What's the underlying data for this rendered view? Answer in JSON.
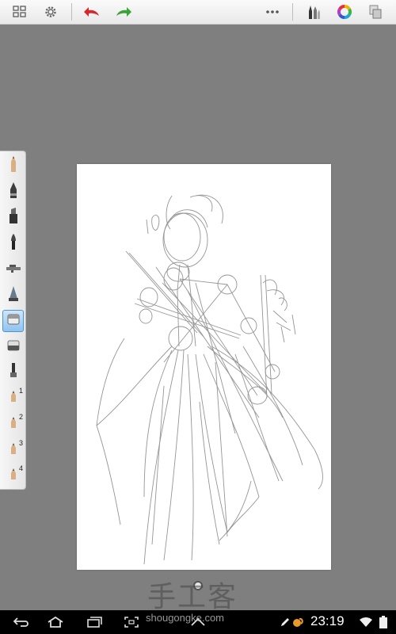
{
  "toolbar": {
    "icons": [
      "grid-icon",
      "gear-icon",
      "undo-icon",
      "redo-icon",
      "more-icon",
      "brush-library-icon",
      "color-wheel-icon",
      "layers-icon"
    ],
    "colors": {
      "undo": "#d9262c",
      "redo": "#3aa33a"
    }
  },
  "palette": {
    "tools": [
      {
        "icon": "pencil-icon"
      },
      {
        "icon": "ballpoint-pen-icon"
      },
      {
        "icon": "marker-icon"
      },
      {
        "icon": "paintbrush-icon"
      },
      {
        "icon": "airbrush-icon"
      },
      {
        "icon": "smudge-icon"
      },
      {
        "icon": "eraser-icon",
        "active": true
      },
      {
        "icon": "soft-eraser-icon"
      },
      {
        "icon": "flat-brush-icon"
      },
      {
        "icon": "custom-brush-icon",
        "number": "1"
      },
      {
        "icon": "custom-brush-icon",
        "number": "2"
      },
      {
        "icon": "custom-brush-icon",
        "number": "3"
      },
      {
        "icon": "custom-brush-icon",
        "number": "4"
      }
    ]
  },
  "watermark": {
    "text": "手工客",
    "url": "shougongke.com"
  },
  "statusbar": {
    "time": "23:19"
  }
}
